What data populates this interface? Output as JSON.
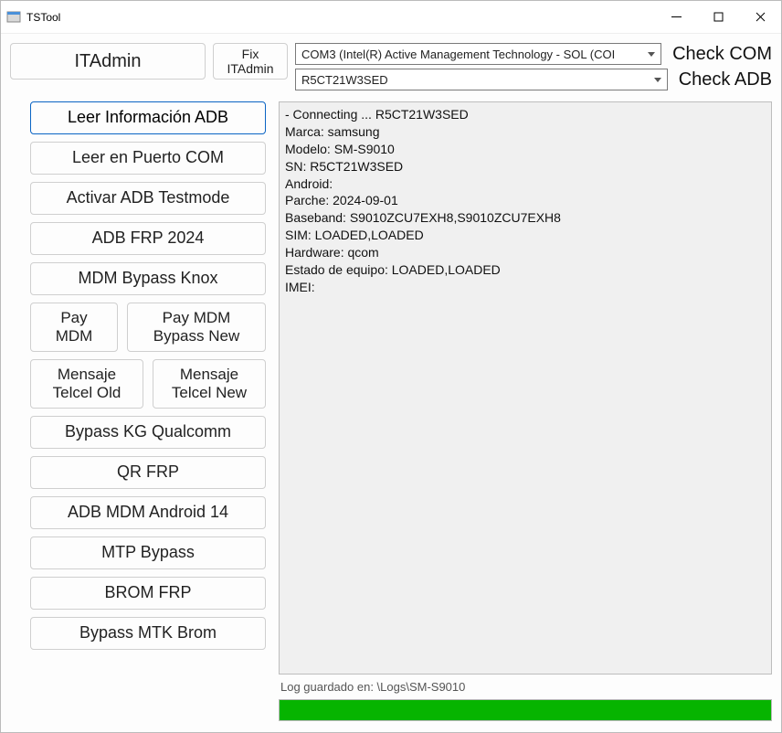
{
  "window": {
    "title": "TSTool"
  },
  "top": {
    "itadmin": "ITAdmin",
    "fix_itadmin": "Fix ITAdmin",
    "com_combo": "COM3 (Intel(R) Active Management Technology - SOL (COI",
    "adb_combo": "R5CT21W3SED",
    "check_com": "Check COM",
    "check_adb": "Check ADB"
  },
  "buttons": {
    "leer_adb": "Leer Información ADB",
    "leer_com": "Leer en Puerto COM",
    "activar_adb": "Activar ADB Testmode",
    "adb_frp": "ADB FRP 2024",
    "mdm_bypass_knox": "MDM Bypass Knox",
    "pay_mdm": "Pay\nMDM",
    "pay_mdm_bypass": "Pay MDM\nBypass New",
    "mensaje_old": "Mensaje\nTelcel Old",
    "mensaje_new": "Mensaje\nTelcel New",
    "bypass_kg": "Bypass KG Qualcomm",
    "qr_frp": "QR FRP",
    "adb_mdm_14": "ADB MDM Android 14",
    "mtp_bypass": "MTP Bypass",
    "brom_frp": "BROM FRP",
    "bypass_mtk": "Bypass MTK Brom"
  },
  "log": {
    "text": "- Connecting ... R5CT21W3SED\nMarca: samsung\nModelo: SM-S9010\nSN: R5CT21W3SED\nAndroid:\nParche: 2024-09-01\nBaseband: S9010ZCU7EXH8,S9010ZCU7EXH8\nSIM: LOADED,LOADED\nHardware: qcom\nEstado de equipo: LOADED,LOADED\nIMEI:"
  },
  "status": {
    "text": "Log guardado en: \\Logs\\SM-S9010"
  },
  "progress": {
    "percent": 100
  }
}
